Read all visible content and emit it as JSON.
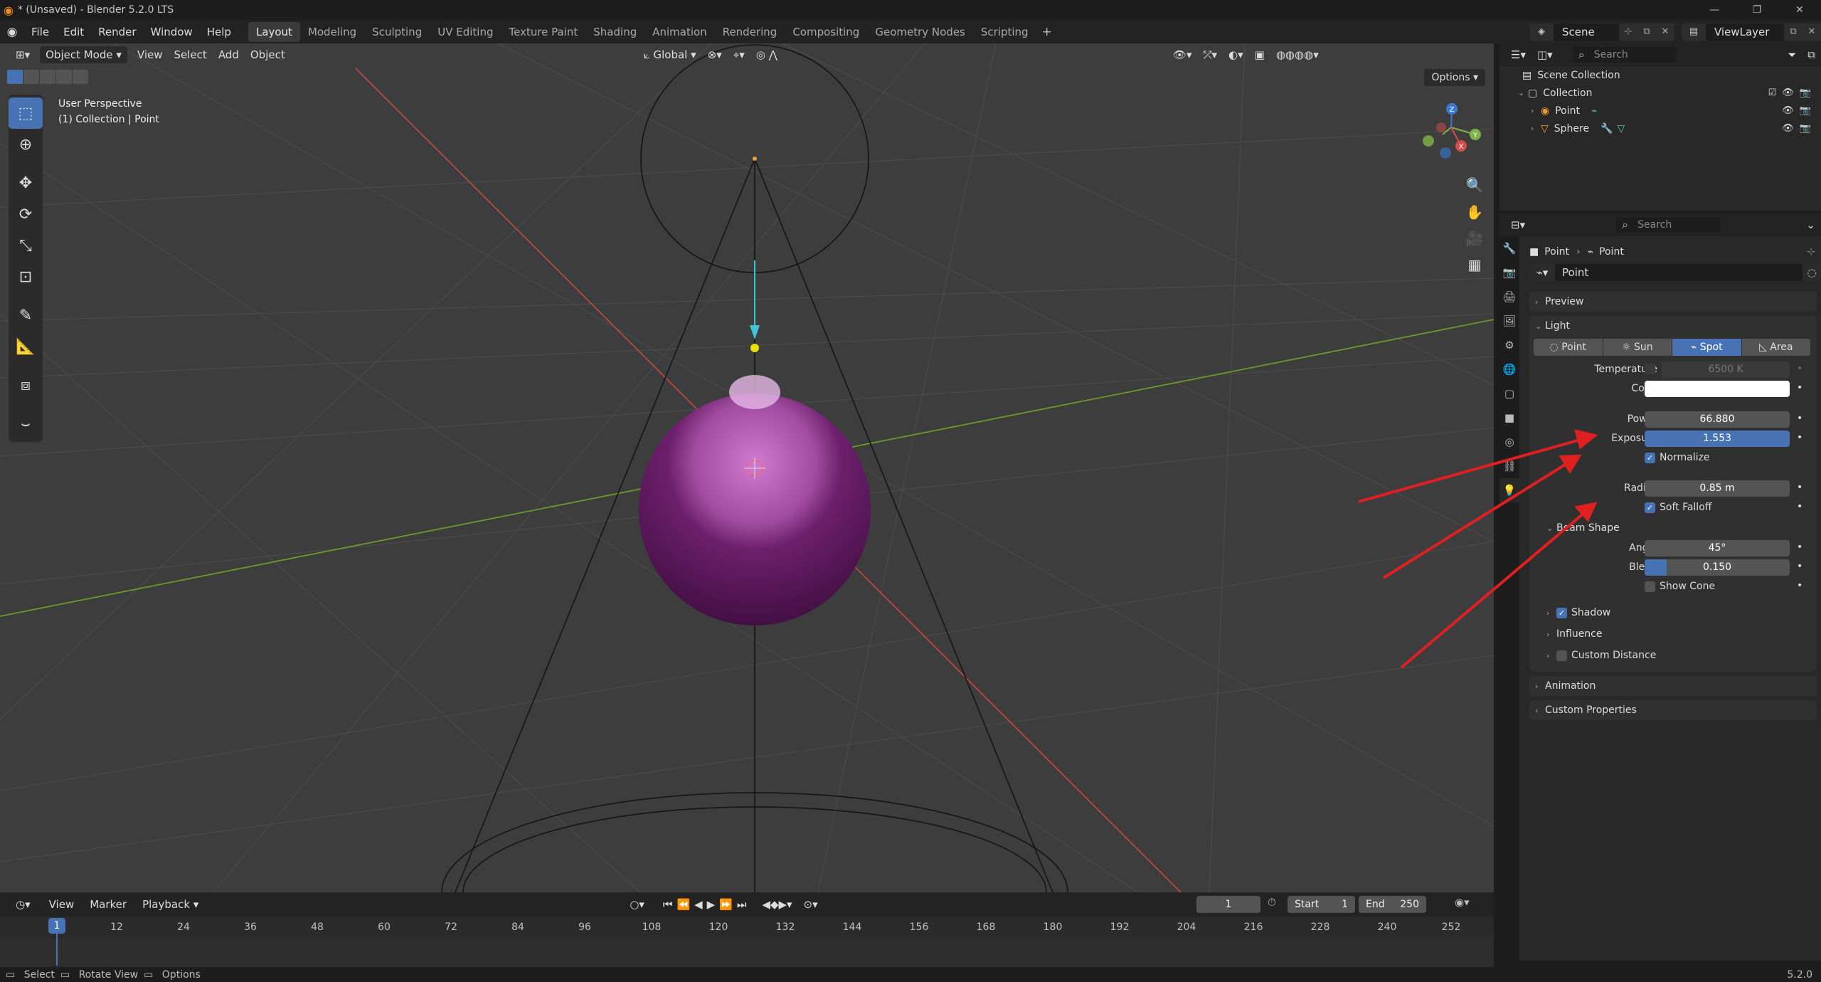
{
  "window": {
    "title": "* (Unsaved) - Blender 5.2.0 LTS"
  },
  "menus": [
    "File",
    "Edit",
    "Render",
    "Window",
    "Help"
  ],
  "workspaces": [
    "Layout",
    "Modeling",
    "Sculpting",
    "UV Editing",
    "Texture Paint",
    "Shading",
    "Animation",
    "Rendering",
    "Compositing",
    "Geometry Nodes",
    "Scripting"
  ],
  "active_workspace": "Layout",
  "scene": {
    "name": "Scene",
    "view_layer": "ViewLayer"
  },
  "viewport": {
    "mode": "Object Mode",
    "menus": [
      "View",
      "Select",
      "Add",
      "Object"
    ],
    "orientation": "Global",
    "options_label": "Options",
    "info_line1": "User Perspective",
    "info_line2": "(1) Collection | Point",
    "gizmo_axes": {
      "x": "X",
      "y": "Y",
      "z": "Z"
    },
    "colors": {
      "background": "#3d3d3d",
      "sphere": "#a04ca0",
      "x_axis": "#c44a4a",
      "y_axis": "#6a9a2a",
      "light_line": "#3ec6d8"
    }
  },
  "outliner": {
    "search_placeholder": "Search",
    "root": "Scene Collection",
    "collection": "Collection",
    "items": [
      {
        "name": "Point"
      },
      {
        "name": "Sphere"
      }
    ]
  },
  "properties": {
    "search_placeholder": "Search",
    "breadcrumb": {
      "object": "Point",
      "data": "Point"
    },
    "datablock": "Point",
    "panels": {
      "preview": "Preview",
      "light": "Light",
      "animation": "Animation",
      "custom_properties": "Custom Properties"
    },
    "light_types": [
      "Point",
      "Sun",
      "Spot",
      "Area"
    ],
    "active_light_type": "Spot",
    "temperature": {
      "label": "Temperature",
      "value": "6500 K"
    },
    "color": {
      "label": "Color",
      "value": "#ffffff"
    },
    "power": {
      "label": "Power",
      "value": "66.880"
    },
    "exposure": {
      "label": "Exposure",
      "value": "1.553"
    },
    "normalize": {
      "label": "Normalize",
      "checked": true
    },
    "radius": {
      "label": "Radius",
      "value": "0.85 m"
    },
    "soft_falloff": {
      "label": "Soft Falloff",
      "checked": true
    },
    "beam_shape": {
      "label": "Beam Shape",
      "angle": {
        "label": "Angle",
        "value": "45°"
      },
      "blend": {
        "label": "Blend",
        "value": "0.150",
        "fraction": 0.15
      },
      "show_cone": {
        "label": "Show Cone",
        "checked": false
      }
    },
    "shadow": {
      "label": "Shadow",
      "checked": true
    },
    "influence": {
      "label": "Influence"
    },
    "custom_distance": {
      "label": "Custom Distance",
      "checked": false
    }
  },
  "timeline": {
    "menus": [
      "View",
      "Marker",
      "Playback"
    ],
    "current_frame": "1",
    "start_label": "Start",
    "start": "1",
    "end_label": "End",
    "end": "250",
    "frames": [
      "12",
      "24",
      "36",
      "48",
      "60",
      "72",
      "84",
      "96",
      "108",
      "120",
      "132",
      "144",
      "156",
      "168",
      "180",
      "192",
      "204",
      "216",
      "228",
      "240",
      "252"
    ]
  },
  "status": {
    "select": "Select",
    "rotate": "Rotate View",
    "options": "Options",
    "version": "5.2.0"
  }
}
